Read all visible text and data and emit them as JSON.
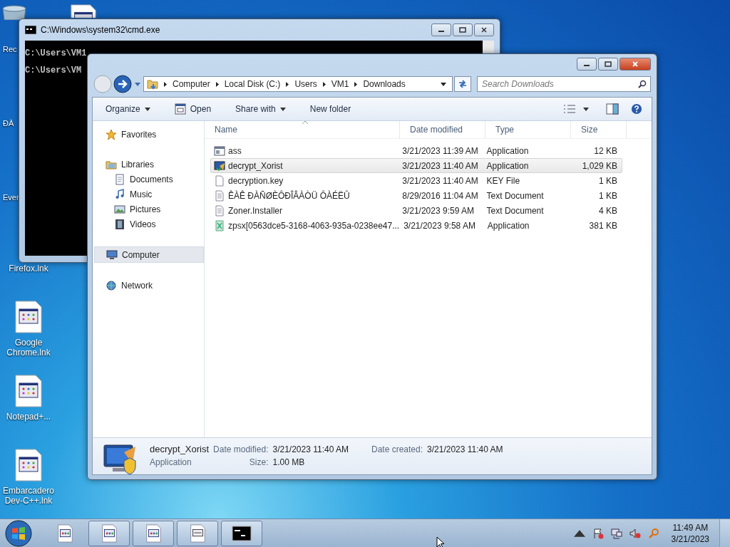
{
  "desktop_icons": [
    {
      "label": "Rec",
      "kind": "partial"
    },
    {
      "label": "ĐÀ",
      "kind": "partial"
    },
    {
      "label": "Ever",
      "kind": "partial"
    },
    {
      "label": "Firefox.lnk",
      "kind": "full"
    },
    {
      "label": "Google Chrome.lnk",
      "kind": "full"
    },
    {
      "label": "Notepad+...",
      "kind": "full"
    },
    {
      "label": "Embarcadero Dev-C++.lnk",
      "kind": "full"
    }
  ],
  "cmd_window": {
    "title": "C:\\Windows\\system32\\cmd.exe",
    "lines": [
      "C:\\Users\\VM1",
      "C:\\Users\\VM"
    ]
  },
  "explorer": {
    "breadcrumbs": [
      "Computer",
      "Local Disk (C:)",
      "Users",
      "VM1",
      "Downloads"
    ],
    "search": {
      "placeholder": "Search Downloads"
    },
    "toolbar": [
      {
        "label": "Organize",
        "kind": "menu"
      },
      {
        "label": "Open",
        "kind": "open"
      },
      {
        "label": "Share with",
        "kind": "menu"
      },
      {
        "label": "New folder",
        "kind": "plain"
      }
    ],
    "nav": [
      {
        "label": "Favorites",
        "selected": false
      },
      {
        "label": "Libraries",
        "selected": false,
        "children": [
          {
            "label": "Documents",
            "selected": false
          },
          {
            "label": "Music",
            "selected": false
          },
          {
            "label": "Pictures",
            "selected": false
          },
          {
            "label": "Videos",
            "selected": false
          }
        ]
      },
      {
        "label": "Computer",
        "selected": true
      },
      {
        "label": "Network",
        "selected": false
      }
    ],
    "columns": [
      {
        "label": "Name",
        "sorted": true
      },
      {
        "label": "Date modified",
        "sorted": false
      },
      {
        "label": "Type",
        "sorted": false
      },
      {
        "label": "Size",
        "sorted": false
      }
    ],
    "files": [
      {
        "name": "ass",
        "date": "3/21/2023 11:39 AM",
        "type": "Application",
        "size": "12 KB",
        "selected": false
      },
      {
        "name": "decrypt_Xorist",
        "date": "3/21/2023 11:40 AM",
        "type": "Application",
        "size": "1,029 KB",
        "selected": true
      },
      {
        "name": "decryption.key",
        "date": "3/21/2023 11:40 AM",
        "type": "KEY File",
        "size": "1 KB",
        "selected": false
      },
      {
        "name": "ÊÀÊ ĐÀÑØÈÔĐÎÂÀÒÜ ÔÀÉËÛ",
        "date": "8/29/2016 11:04 AM",
        "type": "Text Document",
        "size": "1 KB",
        "selected": false
      },
      {
        "name": "Zoner.Installer",
        "date": "3/21/2023 9:59 AM",
        "type": "Text Document",
        "size": "4 KB",
        "selected": false
      },
      {
        "name": "zpsx[0563dce5-3168-4063-935a-0238ee47...",
        "date": "3/21/2023 9:58 AM",
        "type": "Application",
        "size": "381 KB",
        "selected": false
      }
    ],
    "details": {
      "name": "decrypt_Xorist",
      "type": "Application",
      "modified_label": "Date modified:",
      "modified": "3/21/2023 11:40 AM",
      "size_label": "Size:",
      "size": "1.00 MB",
      "created_label": "Date created:",
      "created": "3/21/2023 11:40 AM"
    }
  },
  "taskbar": {
    "buttons": [
      {
        "kind": "doc",
        "running": false
      },
      {
        "kind": "doc",
        "running": true
      },
      {
        "kind": "doc",
        "running": true
      },
      {
        "kind": "text",
        "running": true
      },
      {
        "kind": "console",
        "running": true
      }
    ],
    "time": "11:49 AM",
    "date": "3/21/2023"
  }
}
